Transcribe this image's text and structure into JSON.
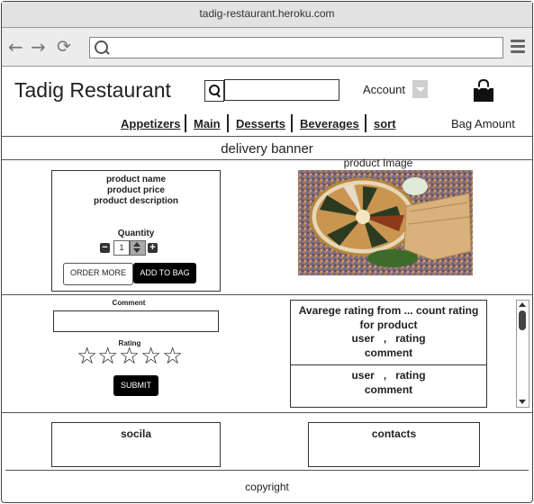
{
  "browser": {
    "url_title": "tadig-restaurant.heroku.com",
    "icons": [
      "back-arrow-icon",
      "forward-arrow-icon",
      "reload-icon",
      "search-icon",
      "hamburger-menu-icon"
    ]
  },
  "header": {
    "brand": "Tadig Restaurant",
    "account_label": "Account",
    "bag_icon": "shopping-bag-icon"
  },
  "nav": {
    "items": [
      "Appetizers",
      "Main",
      "Desserts",
      "Beverages",
      "sort"
    ],
    "bag_amount": "Bag Amount"
  },
  "banner": "delivery banner",
  "product": {
    "name": "product name",
    "price": "product price",
    "description": "product description",
    "quantity_label": "Quantity",
    "quantity_value": "1",
    "order_more": "ORDER MORE",
    "add_to_bag": "ADD TO BAG",
    "image_label": "product Image"
  },
  "review_form": {
    "comment_label": "Comment",
    "rating_label": "Rating",
    "stars": 5,
    "submit": "SUBMIT"
  },
  "reviews": {
    "summary_line1": "Avarege rating from ... count rating",
    "summary_line2": "for product",
    "items": [
      {
        "user": "user",
        "sep": ",",
        "rating": "rating",
        "comment": "comment"
      },
      {
        "user": "user",
        "sep": ",",
        "rating": "rating",
        "comment": "comment"
      }
    ]
  },
  "footer": {
    "social": "socila",
    "contacts": "contacts",
    "copyright": "copyright"
  }
}
